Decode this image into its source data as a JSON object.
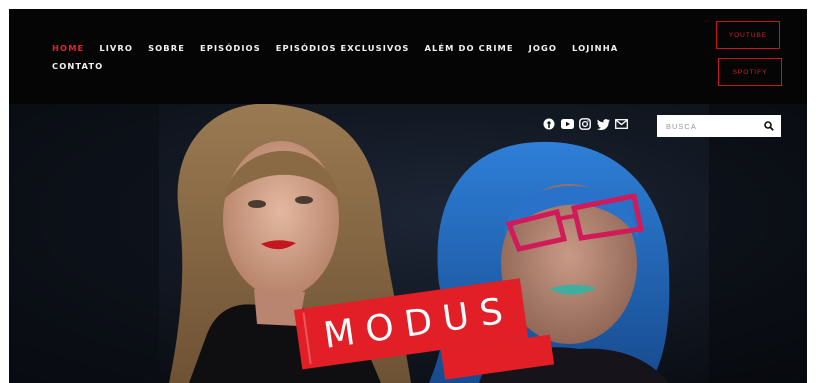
{
  "nav": {
    "items": [
      {
        "label": "HOME",
        "active": true
      },
      {
        "label": "LIVRO"
      },
      {
        "label": "SOBRE"
      },
      {
        "label": "EPISÓDIOS"
      },
      {
        "label": "EPISÓDIOS EXCLUSIVOS"
      },
      {
        "label": "ALÉM DO CRIME"
      },
      {
        "label": "JOGO"
      },
      {
        "label": "LOJINHA"
      },
      {
        "label": "CONTATO"
      }
    ]
  },
  "external_buttons": {
    "youtube": "YOUTUBE",
    "spotify": "SPOTIFY"
  },
  "social_icons": [
    "podcast-icon",
    "youtube-icon",
    "instagram-icon",
    "twitter-icon",
    "mail-icon"
  ],
  "search": {
    "placeholder": "BUSCA"
  },
  "hero": {
    "logo_text": "MODUS"
  },
  "colors": {
    "accent": "#e21f26",
    "nav_bg": "#050505",
    "hero_bg": "#0b0d12",
    "hair_blue": "#1f66c7"
  }
}
